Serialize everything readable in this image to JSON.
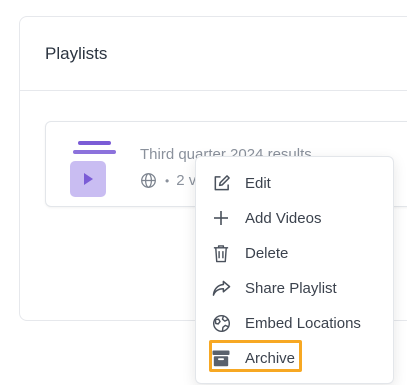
{
  "panel": {
    "title": "Playlists"
  },
  "playlist": {
    "title": "Third quarter 2024 results",
    "visibility_icon": "globe-icon",
    "separator": "•",
    "meta_text": "2 v"
  },
  "menu": {
    "items": [
      {
        "label": "Edit",
        "icon": "edit-icon"
      },
      {
        "label": "Add Videos",
        "icon": "plus-icon"
      },
      {
        "label": "Delete",
        "icon": "trash-icon"
      },
      {
        "label": "Share Playlist",
        "icon": "share-icon"
      },
      {
        "label": "Embed Locations",
        "icon": "embed-globe-icon"
      },
      {
        "label": "Archive",
        "icon": "archive-icon"
      }
    ],
    "highlighted": "Archive"
  },
  "colors": {
    "accent": "#7b5cd6",
    "thumb_bg": "#c9bdf2",
    "highlight": "#f7a823",
    "border": "#e6e8ec"
  }
}
